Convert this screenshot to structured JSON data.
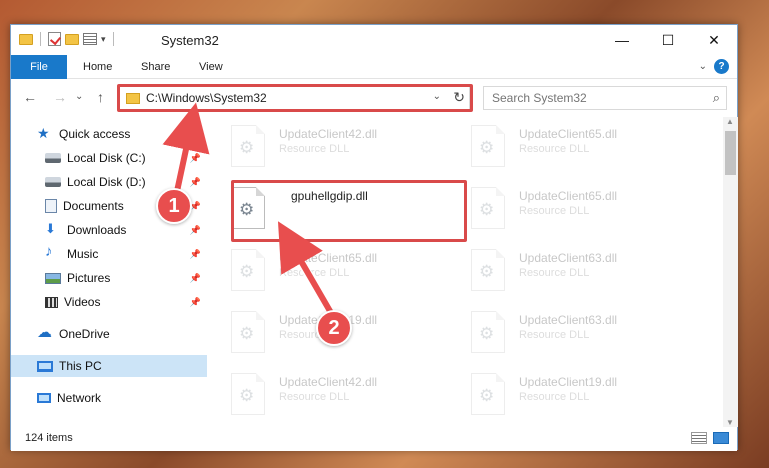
{
  "window": {
    "title": "System32",
    "minimize_glyph": "—",
    "maximize_glyph": "☐",
    "close_glyph": "✕"
  },
  "ribbon": {
    "tabs": [
      "File",
      "Home",
      "Share",
      "View"
    ],
    "expand_glyph": "⌄",
    "help_glyph": "?"
  },
  "address": {
    "path": "C:\\Windows\\System32",
    "search_placeholder": "Search System32",
    "back_glyph": "←",
    "forward_glyph": "→",
    "recent_glyph": "⌄",
    "up_glyph": "↑",
    "chev_glyph": "⌄",
    "refresh_glyph": "↻",
    "search_glyph": "⌕"
  },
  "sidebar": {
    "items": [
      {
        "label": "Quick access",
        "icon": "quick-access-star-icon"
      },
      {
        "label": "Local Disk (C:)",
        "icon": "drive-icon"
      },
      {
        "label": "Local Disk (D:)",
        "icon": "drive-icon"
      },
      {
        "label": "Documents",
        "icon": "documents-icon"
      },
      {
        "label": "Downloads",
        "icon": "downloads-icon"
      },
      {
        "label": "Music",
        "icon": "music-icon"
      },
      {
        "label": "Pictures",
        "icon": "pictures-icon"
      },
      {
        "label": "Videos",
        "icon": "videos-icon"
      },
      {
        "label": "OneDrive",
        "icon": "onedrive-icon"
      },
      {
        "label": "This PC",
        "icon": "this-pc-icon"
      },
      {
        "label": "Network",
        "icon": "network-icon"
      }
    ],
    "pin_glyph": "📌"
  },
  "files": [
    {
      "name": "UpdateClient42.dll",
      "desc": "Resource DLL"
    },
    {
      "name": "UpdateClient65.dll",
      "desc": "Resource DLL"
    },
    {
      "name": "gpuhellgdip.dll",
      "desc": ""
    },
    {
      "name": "UpdateClient65.dll",
      "desc": "Resource DLL"
    },
    {
      "name": "UpdateClient65.dll",
      "desc": "Resource DLL"
    },
    {
      "name": "UpdateClient63.dll",
      "desc": "Resource DLL"
    },
    {
      "name": "UpdateClient19.dll",
      "desc": "Resource DLL"
    },
    {
      "name": "UpdateClient63.dll",
      "desc": "Resource DLL"
    },
    {
      "name": "UpdateClient42.dll",
      "desc": "Resource DLL"
    },
    {
      "name": "UpdateClient19.dll",
      "desc": "Resource DLL"
    }
  ],
  "gear_glyph": "⚙",
  "status": {
    "item_count": "124 items"
  },
  "scroll": {
    "up_glyph": "▲",
    "down_glyph": "▼"
  },
  "annotations": {
    "step1": "1",
    "step2": "2"
  },
  "colors": {
    "accent": "#1979ca",
    "highlight": "#d94a4a",
    "selected": "#cce4f7"
  }
}
